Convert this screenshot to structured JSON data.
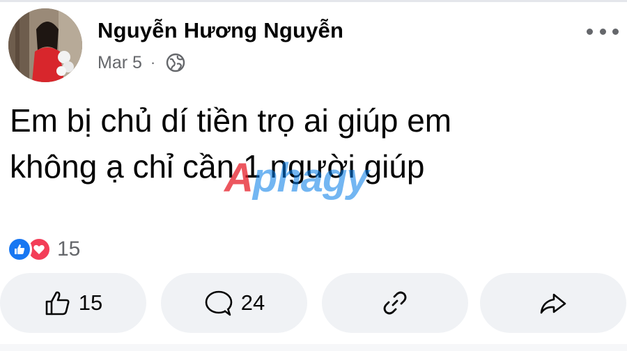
{
  "post": {
    "author": "Nguyễn Hương Nguyễn",
    "date": "Mar 5",
    "separator": "·",
    "privacy_icon": "globe-icon",
    "text_lines": [
      "Em bị chủ dí tiền trọ ai giúp em",
      "không ạ chỉ cần 1 người giúp"
    ]
  },
  "watermark": {
    "red_part": "A",
    "blue_part": "phagy"
  },
  "reactions": {
    "icons": [
      "like-icon",
      "love-icon"
    ],
    "count": "15"
  },
  "actions": {
    "like_count": "15",
    "comment_count": "24",
    "link_icon": "link-icon",
    "share_icon": "share-icon"
  },
  "colors": {
    "like_blue": "#1877f2",
    "love_red": "#f33e58",
    "button_bg": "#f0f2f5",
    "secondary_text": "#65676b"
  }
}
